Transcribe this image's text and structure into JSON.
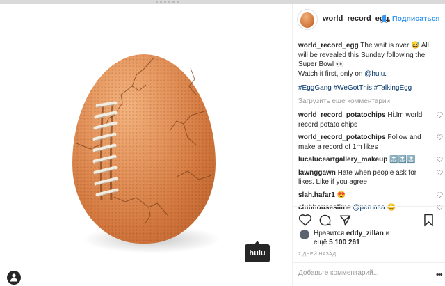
{
  "post": {
    "username": "world_record_egg",
    "follow_label": "Подписаться",
    "image_tooltip": "hulu",
    "caption": {
      "username": "world_record_egg",
      "text_1": " The wait is over ",
      "emoji_1": "😅",
      "text_2": " All will be revealed this Sunday following the Super Bowl ",
      "emoji_2": "👀",
      "text_3": "Watch it first, only on ",
      "mention": "@hulu",
      "text_4": ".",
      "hashtags": "#EggGang #WeGotThis #TalkingEgg"
    },
    "load_more_label": "Загрузить еще комментарии",
    "comments": [
      {
        "user": "world_record_potatochips",
        "text": " Hi.Im world record potato chips"
      },
      {
        "user": "world_record_potatochips",
        "text": " Follow and make a record of 1m likes"
      },
      {
        "user": "lucaluceartgallery_makeup",
        "text": " 🔝🔝🔝"
      },
      {
        "user": "lawnggawn",
        "text": " Hate when people ask for likes. Like if you agree"
      },
      {
        "user": "slah.hafar1",
        "text": " 😍"
      },
      {
        "user": "clubhouseslime",
        "mention": "@pen.nea",
        "text": " 😊"
      }
    ],
    "likes": {
      "line1_prefix": "Нравится ",
      "liker": "eddy_zillan",
      "line1_suffix": " и",
      "line2_prefix": "ещё ",
      "count": "5 100 261"
    },
    "timestamp": "2 ДНЕЙ НАЗАД",
    "add_comment_placeholder": "Добавьте комментарий...",
    "more_label": "•••"
  },
  "icons": {
    "heart": "heart-icon",
    "comment": "comment-icon",
    "share": "share-icon",
    "bookmark": "bookmark-icon",
    "user_tag": "user-tag-icon"
  },
  "colors": {
    "link_blue": "#3897f0",
    "hashtag": "#003569",
    "text": "#262626",
    "muted": "#999999",
    "tooltip_bg": "#262626"
  }
}
